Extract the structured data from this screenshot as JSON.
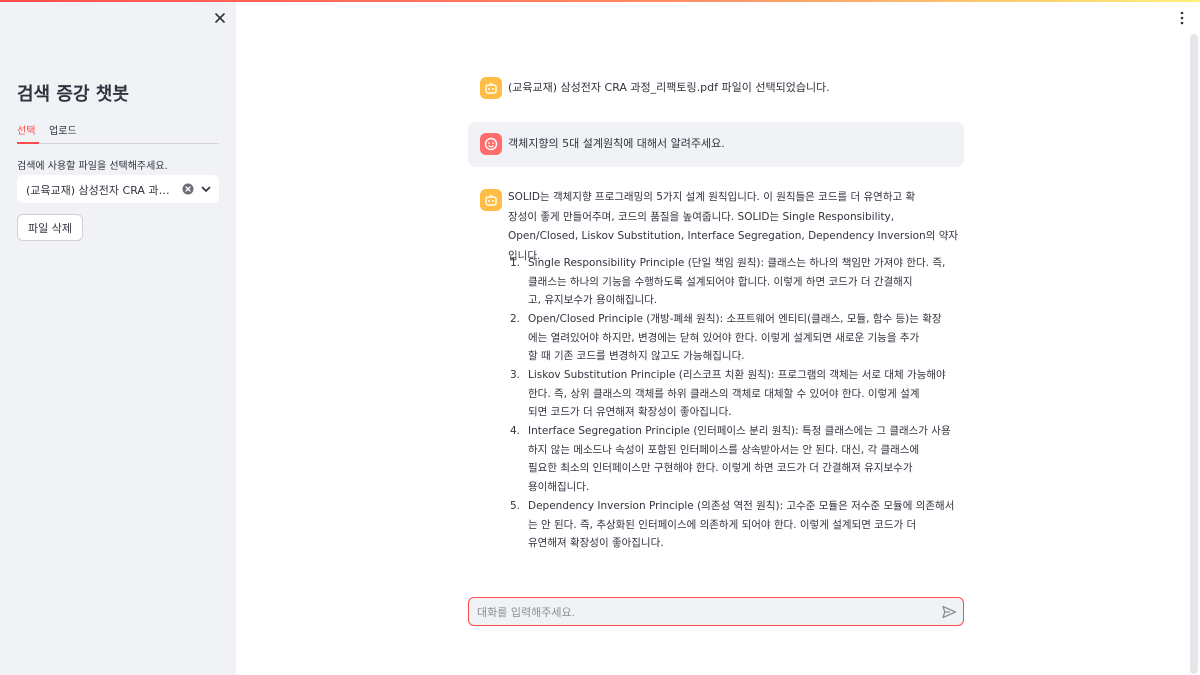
{
  "sidebar": {
    "title": "검색 증강 챗봇",
    "tabs": [
      {
        "label": "선택",
        "active": true
      },
      {
        "label": "업로드",
        "active": false
      }
    ],
    "select_label": "검색에 사용할 파일을 선택해주세요.",
    "selected_file": "(교육교재) 삼성전자 CRA 과정_리팩토링.pdf",
    "delete_button": "파일 삭제",
    "icons": {
      "close": "close-icon",
      "clear": "clear-icon",
      "dropdown": "chevron-down-icon"
    }
  },
  "chat": {
    "messages": [
      {
        "role": "assistant",
        "avatar": "bot-icon",
        "text": "(교육교재) 삼성전자 CRA 과정_리팩토링.pdf 파일이 선택되었습니다."
      },
      {
        "role": "user",
        "avatar": "user-face-icon",
        "text": "객체지향의 5대 설계원칙에 대해서 알려주세요."
      },
      {
        "role": "assistant",
        "avatar": "bot-icon",
        "intro_lines": [
          "SOLID는 객체지향 프로그래밍의 5가지 설계 원칙입니다. 이 원칙들은 코드를 더 유연하고 확",
          "장성이 좋게 만들어주며, 코드의 품질을 높여줍니다. SOLID는 Single Responsibility,",
          "Open/Closed, Liskov Substitution, Interface Segregation, Dependency Inversion의 약자입니다."
        ],
        "items": [
          {
            "num": "1.",
            "lines": [
              "Single Responsibility Principle (단일 책임 원칙): 클래스는 하나의 책임만 가져야 한다. 즉,",
              "클래스는 하나의 기능을 수행하도록 설계되어야 합니다. 이렇게 하면 코드가 더 간결해지",
              "고, 유지보수가 용이해집니다."
            ]
          },
          {
            "num": "2.",
            "lines": [
              "Open/Closed Principle (개방-폐쇄 원칙): 소프트웨어 엔티티(클래스, 모듈, 함수 등)는 확장",
              "에는 열려있어야 하지만, 변경에는 닫혀 있어야 한다. 이렇게 설계되면 새로운 기능을 추가",
              "할 때 기존 코드를 변경하지 않고도 가능해집니다."
            ]
          },
          {
            "num": "3.",
            "lines": [
              "Liskov Substitution Principle (리스코프 치환 원칙): 프로그램의 객체는 서로 대체 가능해야",
              "한다. 즉, 상위 클래스의 객체를 하위 클래스의 객체로 대체할 수 있어야 한다. 이렇게 설계",
              "되면 코드가 더 유연해져 확장성이 좋아집니다."
            ]
          },
          {
            "num": "4.",
            "lines": [
              "Interface Segregation Principle (인터페이스 분리 원칙): 특정 클래스에는 그 클래스가 사용",
              "하지 않는 메소드나 속성이 포함된 인터페이스를 상속받아서는 안 된다. 대신, 각 클래스에",
              "필요한 최소의 인터페이스만 구현해야 한다. 이렇게 하면 코드가 더 간결해져 유지보수가",
              "용이해집니다."
            ]
          },
          {
            "num": "5.",
            "lines": [
              "Dependency Inversion Principle (의존성 역전 원칙): 고수준 모듈은 저수준 모듈에 의존해서",
              "는 안 된다. 즉, 추상화된 인터페이스에 의존하게 되어야 한다. 이렇게 설계되면 코드가 더",
              "유연해져 확장성이 좋아집니다."
            ]
          }
        ]
      }
    ],
    "input_placeholder": "대화를 입력해주세요.",
    "input_value": "",
    "send_icon": "send-icon"
  },
  "header": {
    "menu_icon": "kebab-menu-icon"
  },
  "colors": {
    "accent": "#ff4b4b",
    "sidebar_bg": "#f0f2f6",
    "bot_avatar": "#ffbd45",
    "user_avatar": "#ff6c6c",
    "text": "#31333f"
  }
}
